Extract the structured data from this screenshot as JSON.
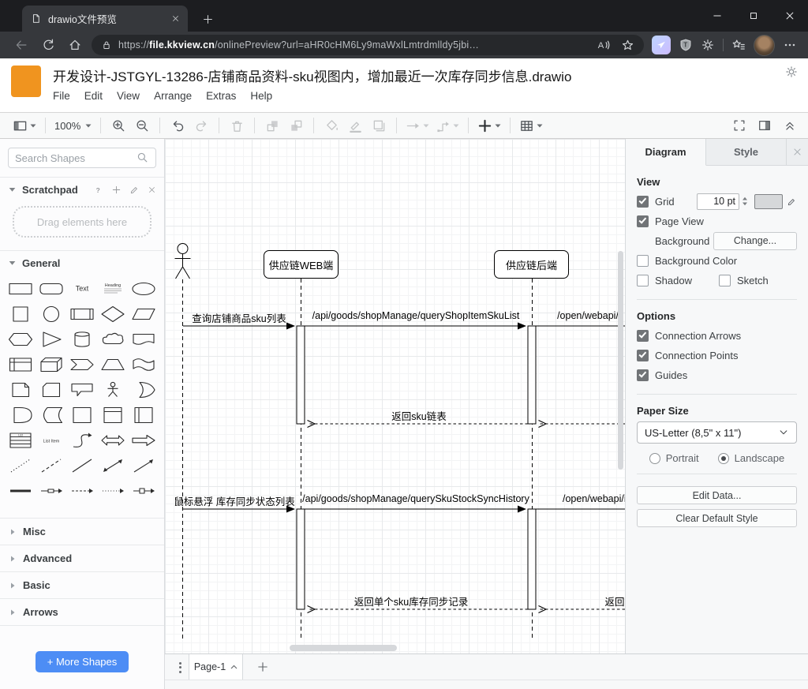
{
  "browser": {
    "tab_title": "drawio文件预览",
    "url_protocol": "https://",
    "url_host": "file.kkview.cn",
    "url_path": "/onlinePreview?url=aHR0cHM6Ly9maWxlLmtrdmlldy5jbi…"
  },
  "app": {
    "title": "开发设计-JSTGYL-13286-店铺商品资料-sku视图内，增加最近一次库存同步信息.drawio",
    "menu": [
      "File",
      "Edit",
      "View",
      "Arrange",
      "Extras",
      "Help"
    ],
    "toolbar_groups": [
      {
        "items": [
          {
            "icon": "view-panels-icon",
            "caret": true,
            "enabled": true
          }
        ]
      },
      {
        "items": [
          {
            "name": "zoom-level",
            "text": "100%",
            "caret": true,
            "enabled": true
          }
        ]
      },
      {
        "items": [
          {
            "icon": "zoom-in-icon",
            "enabled": true
          },
          {
            "icon": "zoom-out-icon",
            "enabled": true
          }
        ]
      },
      {
        "items": [
          {
            "icon": "undo-icon",
            "enabled": true
          },
          {
            "icon": "redo-icon",
            "enabled": false
          }
        ]
      },
      {
        "items": [
          {
            "icon": "delete-icon",
            "enabled": false
          }
        ]
      },
      {
        "items": [
          {
            "icon": "to-front-icon",
            "enabled": false
          },
          {
            "icon": "to-back-icon",
            "enabled": false
          }
        ]
      },
      {
        "items": [
          {
            "icon": "fill-color-icon",
            "enabled": false
          },
          {
            "icon": "line-color-icon",
            "enabled": false
          },
          {
            "icon": "shadow-icon",
            "enabled": false
          }
        ]
      },
      {
        "items": [
          {
            "icon": "connection-icon",
            "caret": true,
            "enabled": false
          },
          {
            "icon": "waypoints-icon",
            "caret": true,
            "enabled": false
          }
        ]
      },
      {
        "items": [
          {
            "icon": "insert-icon",
            "caret": true,
            "enabled": true,
            "dark": true
          }
        ]
      },
      {
        "items": [
          {
            "icon": "table-icon",
            "caret": true,
            "enabled": true
          }
        ]
      }
    ],
    "toolbar_right": [
      {
        "icon": "fullscreen-icon"
      },
      {
        "icon": "format-panel-icon"
      },
      {
        "icon": "collapse-icon"
      }
    ]
  },
  "sidebar": {
    "search_placeholder": "Search Shapes",
    "scratchpad_label": "Scratchpad",
    "scratchpad_hint": "Drag elements here",
    "general_label": "General",
    "shape_texts": {
      "text": "Text",
      "heading": "Heading",
      "list": "List",
      "list_item": "List Item"
    },
    "shapes": [
      "rectangle",
      "rounded-rectangle",
      "text",
      "textbox",
      "ellipse",
      "square",
      "circle",
      "process",
      "diamond",
      "parallelogram",
      "hexagon",
      "triangle",
      "cylinder",
      "cloud",
      "document",
      "internal-storage",
      "cube",
      "step",
      "trapezoid",
      "tape",
      "note",
      "card",
      "callout",
      "actor",
      "or",
      "and",
      "data-storage",
      "container",
      "container-title",
      "vertical-container",
      "list",
      "list-item",
      "curve",
      "bidirectional-arrow",
      "arrow",
      "dotted-line",
      "dashed-line",
      "line",
      "bidirectional-connector",
      "directional-connector",
      "link",
      "edge-label",
      "edge-dashed",
      "edge-dotted",
      "edge-node"
    ],
    "collapsed_sections": [
      "Misc",
      "Advanced",
      "Basic",
      "Arrows"
    ],
    "more_shapes_label": "+ More Shapes",
    "accent_color": "#4d8df5"
  },
  "canvas": {
    "lifelines": [
      {
        "label": "供应链WEB端"
      },
      {
        "label": "供应链后端"
      }
    ],
    "messages": [
      {
        "label": "查询店铺商品sku列表"
      },
      {
        "label": "/api/goods/shopManage/queryShopItemSkuList"
      },
      {
        "label": "/open/webapi/"
      },
      {
        "label": "返回sku链表"
      },
      {
        "label": "鼠标悬浮 库存同步状态列表"
      },
      {
        "label": "/api/goods/shopManage/querySkuStockSyncHistory"
      },
      {
        "label": "/open/webapi/iten"
      },
      {
        "label": "返回单个sku库存同步记录"
      },
      {
        "label": "返回"
      }
    ]
  },
  "format_panel": {
    "tabs": [
      {
        "label": "Diagram",
        "active": true
      },
      {
        "label": "Style",
        "active": false
      }
    ],
    "view_header": "View",
    "grid_label": "Grid",
    "grid_size": "10 pt",
    "page_view_label": "Page View",
    "background_label": "Background",
    "change_button": "Change...",
    "background_color_label": "Background Color",
    "shadow_label": "Shadow",
    "sketch_label": "Sketch",
    "options_header": "Options",
    "options": [
      {
        "label": "Connection Arrows",
        "checked": true
      },
      {
        "label": "Connection Points",
        "checked": true
      },
      {
        "label": "Guides",
        "checked": true
      }
    ],
    "paper_header": "Paper Size",
    "paper_value": "US-Letter (8,5\" x 11\")",
    "portrait_label": "Portrait",
    "landscape_label": "Landscape",
    "landscape_selected": true,
    "edit_data_button": "Edit Data...",
    "clear_style_button": "Clear Default Style"
  },
  "page_bar": {
    "page_label": "Page-1"
  },
  "brand": {
    "logo_color": "#f0941f"
  }
}
